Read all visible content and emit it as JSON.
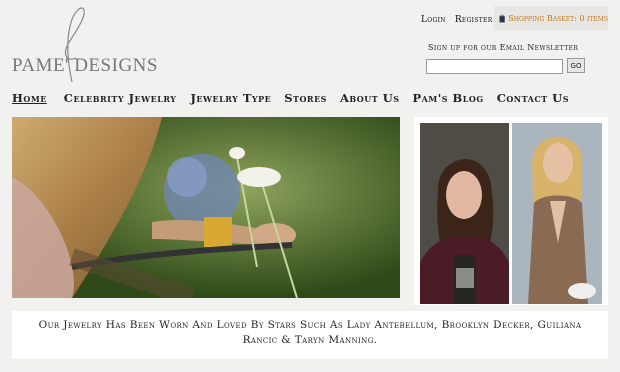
{
  "logo": {
    "text": "PAME' DESIGNS"
  },
  "header": {
    "login": "Login",
    "register": "Register",
    "basket": "Shopping Basket: 0 items",
    "newsletter_label": "Sign up for our Email Newsletter",
    "newsletter_placeholder": "",
    "go_label": "GO"
  },
  "nav": {
    "items": [
      {
        "label": "Home"
      },
      {
        "label": "Celebrity Jewelry"
      },
      {
        "label": "Jewelry Type"
      },
      {
        "label": "Stores"
      },
      {
        "label": "About Us"
      },
      {
        "label": "Pam's Blog"
      },
      {
        "label": "Contact Us"
      }
    ]
  },
  "tagline": "Our Jewelry Has Been Worn And Loved By Stars Such As Lady Antebellum, Brooklyn Decker, Guiliana Rancic & Taryn Manning.",
  "colors": {
    "background": "#f1f1ef",
    "basket_text": "#c0781c",
    "logo_gray": "#777777"
  }
}
